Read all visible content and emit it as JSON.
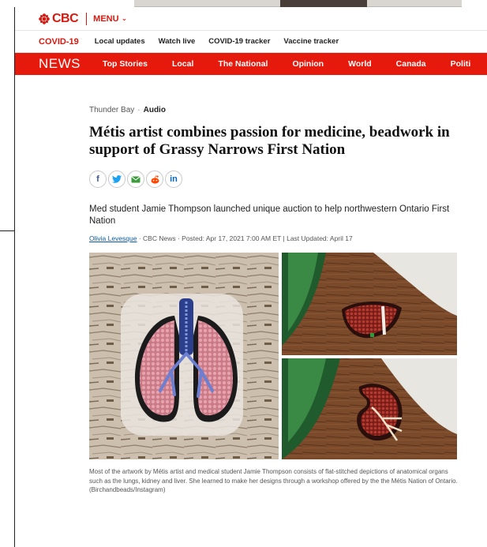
{
  "topbar": {
    "logo_text": "CBC",
    "menu_label": "MENU"
  },
  "covid": {
    "tag": "COVID-19",
    "links": [
      "Local updates",
      "Watch live",
      "COVID-19 tracker",
      "Vaccine tracker"
    ]
  },
  "news": {
    "label": "NEWS",
    "items": [
      "Top Stories",
      "Local",
      "The National",
      "Opinion",
      "World",
      "Canada",
      "Politi"
    ]
  },
  "article": {
    "section": "Thunder Bay",
    "type": "Audio",
    "headline": "Métis artist combines passion for medicine, beadwork in support of Grassy Narrows First Nation",
    "share_icons": [
      "facebook-icon",
      "twitter-icon",
      "email-icon",
      "reddit-icon",
      "linkedin-icon"
    ],
    "deck": "Med student Jamie Thompson launched unique auction to help northwestern Ontario First Nation",
    "author": "Olivia Levesque",
    "byline_rest": " · CBC News · Posted: Apr 17, 2021 7:00 AM ET | Last Updated: April 17",
    "caption": "Most of the artwork by Métis artist and medical student Jamie Thompson consists of flat-stitched depictions of anatomical organs such as the lungs, kidney and liver. She learned to make her designs through a workshop offered by the the Métis Nation of Ontario. (Birchandbeads/Instagram)"
  },
  "colors": {
    "brand_red": "#e51a0d",
    "logo_red": "#d7190f",
    "link_blue": "#0a5ca8"
  }
}
